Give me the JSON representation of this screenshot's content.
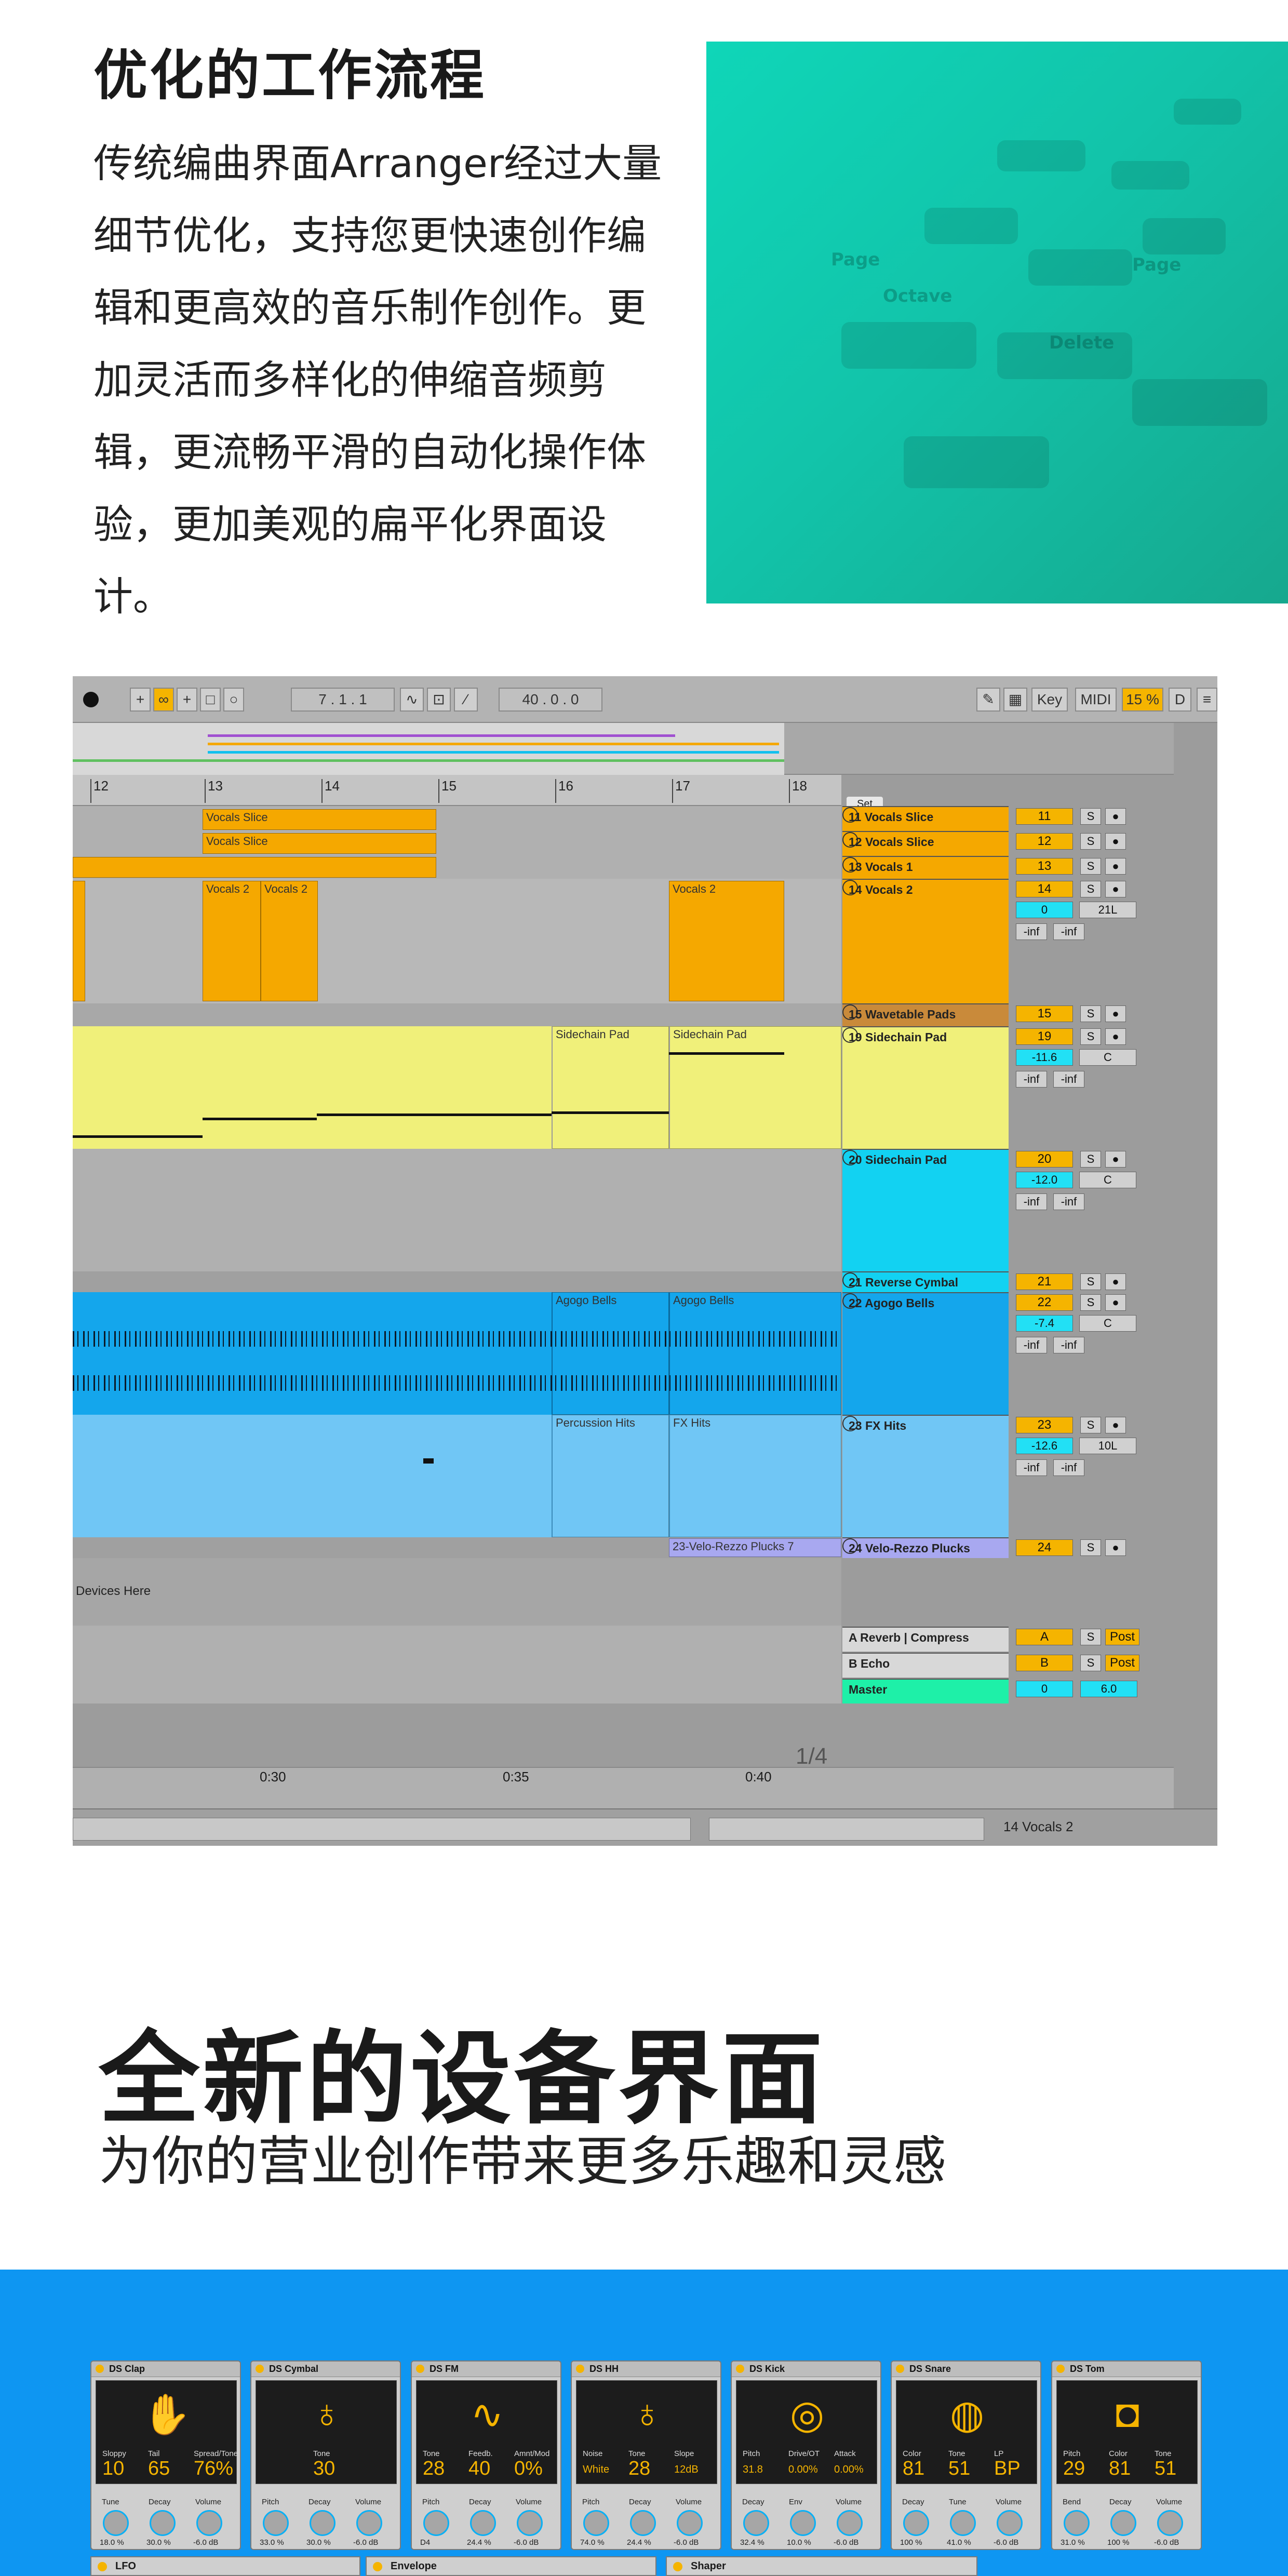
{
  "section1": {
    "title": "优化的工作流程",
    "body": "传统编曲界面Arranger经过大量细节优化，支持您更快速创作编辑和更高效的音乐制作创作。更加灵活而多样化的伸缩音频剪辑，更流畅平滑的自动化操作体验，更加美观的扁平化界面设计。",
    "photo_labels": [
      "Page",
      "Octave",
      "Delete",
      "Page"
    ]
  },
  "daw": {
    "position": "7 . 1 . 1",
    "loop_length": "40 . 0 . 0",
    "key_label": "Key",
    "midi_label": "MIDI",
    "cpu": "15 %",
    "d_label": "D",
    "set_label": "Set",
    "ruler": [
      "12",
      "13",
      "14",
      "15",
      "16",
      "17",
      "18"
    ],
    "time_ruler": [
      "0:30",
      "0:35",
      "0:40"
    ],
    "page_indicator": "1/4",
    "drop_text": "Devices Here",
    "status_track": "14 Vocals 2",
    "clips": {
      "vocals_slice": "Vocals Slice",
      "vocals2": "Vocals 2",
      "sidechain_pad": "Sidechain Pad",
      "agogo_bells": "Agogo Bells",
      "percussion_hits": "Percussion Hits",
      "fx_hits": "FX Hits",
      "plucks": "23-Velo-Rezzo Plucks 7"
    },
    "tracks": [
      {
        "name": "11 Vocals Slice",
        "num": "11",
        "color": "#f5a800"
      },
      {
        "name": "12 Vocals Slice",
        "num": "12",
        "color": "#f5a800"
      },
      {
        "name": "13 Vocals 1",
        "num": "13",
        "color": "#f5a800"
      },
      {
        "name": "14 Vocals 2",
        "num": "14",
        "color": "#f5a800",
        "vol": "0",
        "pan": "21L",
        "inf1": "-inf",
        "inf2": "-inf"
      },
      {
        "name": "15 Wavetable Pads",
        "num": "15",
        "color": "#c98a3a"
      },
      {
        "name": "19 Sidechain Pad",
        "num": "19",
        "color": "#f0f07a",
        "vol": "-11.6",
        "pan": "C",
        "inf1": "-inf",
        "inf2": "-inf"
      },
      {
        "name": "20 Sidechain Pad",
        "num": "20",
        "color": "#12d2f2",
        "vol": "-12.0",
        "pan": "C",
        "inf1": "-inf",
        "inf2": "-inf"
      },
      {
        "name": "21 Reverse Cymbal",
        "num": "21",
        "color": "#12d2f2"
      },
      {
        "name": "22 Agogo Bells",
        "num": "22",
        "color": "#14a6ec",
        "vol": "-7.4",
        "pan": "C",
        "inf1": "-inf",
        "inf2": "-inf"
      },
      {
        "name": "23 FX Hits",
        "num": "23",
        "color": "#70c6f5",
        "vol": "-12.6",
        "pan": "10L",
        "inf1": "-inf",
        "inf2": "-inf"
      },
      {
        "name": "24 Velo-Rezzo Plucks",
        "num": "24",
        "color": "#a8a8f0"
      }
    ],
    "returns": [
      {
        "name": "A Reverb | Compress",
        "num": "A",
        "post": "Post"
      },
      {
        "name": "B Echo",
        "num": "B",
        "post": "Post"
      }
    ],
    "master": {
      "name": "Master",
      "vol": "0",
      "val": "6.0"
    },
    "s_label": "S"
  },
  "section2": {
    "title": "全新的设备界面",
    "subtitle": "为你的营业创作带来更多乐趣和灵感"
  },
  "devices": [
    {
      "name": "DS Clap",
      "icon": "✋",
      "params": [
        {
          "l": "Sloppy",
          "v": "10"
        },
        {
          "l": "Tail",
          "v": "65"
        },
        {
          "l": "Spread/Tone",
          "v": "76%"
        }
      ],
      "knobs": [
        {
          "l": "Tune",
          "v": "18.0 %"
        },
        {
          "l": "Decay",
          "v": "30.0 %"
        },
        {
          "l": "Volume",
          "v": "-6.0 dB"
        }
      ]
    },
    {
      "name": "DS Cymbal",
      "icon": "♁",
      "params": [
        {
          "l": "Tone",
          "v": "30"
        }
      ],
      "knobs": [
        {
          "l": "Pitch",
          "v": "33.0 %"
        },
        {
          "l": "Decay",
          "v": "30.0 %"
        },
        {
          "l": "Volume",
          "v": "-6.0 dB"
        }
      ]
    },
    {
      "name": "DS FM",
      "icon": "∿",
      "params": [
        {
          "l": "Tone",
          "v": "28"
        },
        {
          "l": "Feedb.",
          "v": "40"
        },
        {
          "l": "Amnt/Mod",
          "v": "0%"
        }
      ],
      "knobs": [
        {
          "l": "Pitch",
          "v": "D4"
        },
        {
          "l": "Decay",
          "v": "24.4 %"
        },
        {
          "l": "Volume",
          "v": "-6.0 dB"
        }
      ]
    },
    {
      "name": "DS HH",
      "icon": "♁",
      "params": [
        {
          "l": "Noise",
          "v": "White"
        },
        {
          "l": "Tone",
          "v": "28"
        },
        {
          "l": "Slope",
          "v": "12dB"
        }
      ],
      "knobs": [
        {
          "l": "Pitch",
          "v": "74.0 %"
        },
        {
          "l": "Decay",
          "v": "24.4 %"
        },
        {
          "l": "Volume",
          "v": "-6.0 dB"
        }
      ]
    },
    {
      "name": "DS Kick",
      "icon": "◎",
      "params": [
        {
          "l": "Pitch",
          "v": "31.8"
        },
        {
          "l": "Drive/OT",
          "v": "0.00%"
        },
        {
          "l": "Attack",
          "v": "0.00%"
        }
      ],
      "knobs": [
        {
          "l": "Decay",
          "v": "32.4 %"
        },
        {
          "l": "Env",
          "v": "10.0 %"
        },
        {
          "l": "Volume",
          "v": "-6.0 dB"
        }
      ]
    },
    {
      "name": "DS Snare",
      "icon": "◍",
      "params": [
        {
          "l": "Color",
          "v": "81"
        },
        {
          "l": "Tone",
          "v": "51"
        },
        {
          "l": "LP",
          "v": "BP"
        }
      ],
      "knobs": [
        {
          "l": "Decay",
          "v": "100 %"
        },
        {
          "l": "Tune",
          "v": "41.0 %"
        },
        {
          "l": "Volume",
          "v": "-6.0 dB"
        }
      ]
    },
    {
      "name": "DS Tom",
      "icon": "◘",
      "params": [
        {
          "l": "Pitch",
          "v": "29"
        },
        {
          "l": "Color",
          "v": "81"
        },
        {
          "l": "Tone",
          "v": "51"
        }
      ],
      "knobs": [
        {
          "l": "Bend",
          "v": "31.0 %"
        },
        {
          "l": "Decay",
          "v": "100 %"
        },
        {
          "l": "Volume",
          "v": "-6.0 dB"
        }
      ]
    }
  ],
  "devices_row2": [
    "LFO",
    "Envelope",
    "Shaper"
  ]
}
